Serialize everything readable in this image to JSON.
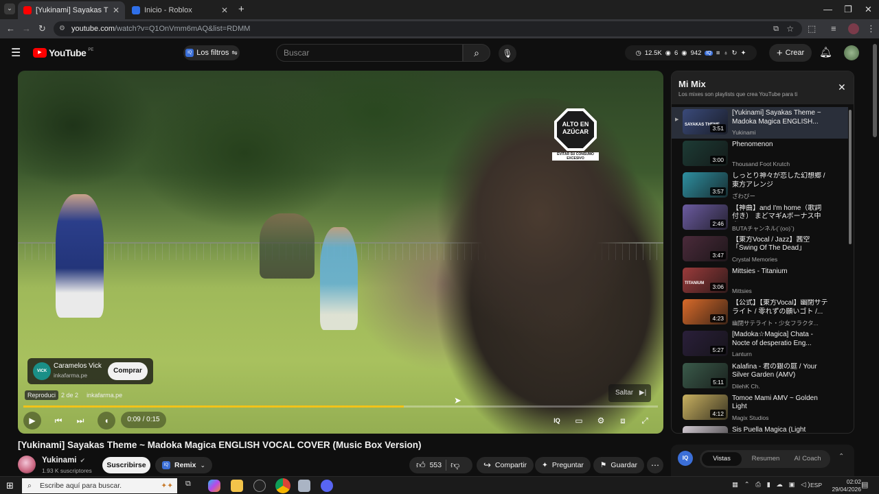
{
  "browser": {
    "tabs": [
      {
        "title": "[Yukinami] Sayakas Theme ~ M",
        "active": true
      },
      {
        "title": "Inicio - Roblox",
        "active": false
      }
    ],
    "url_host": "youtube.com",
    "url_path": "/watch?v=Q1OnVmm6mAQ&list=RDMM",
    "new_tab": "+"
  },
  "yt": {
    "logo": "YouTube",
    "region": "PE",
    "filters_label": "Los filtros",
    "search_placeholder": "Buscar",
    "stats": {
      "views": "12.5K",
      "watching": "6",
      "total": "942"
    },
    "create_label": "Crear"
  },
  "player": {
    "sign_text": "ALTO EN AZÚCAR",
    "sign_sub": "EVITAR SU CONSUMO EXCESIVO",
    "ad_name": "Caramelos Vick",
    "ad_domain": "inkafarma.pe",
    "ad_logo": "VICK",
    "buy_label": "Comprar",
    "ad_info_label": "Reproduci",
    "ad_info_count": "2 de 2",
    "ad_info_domain": "inkafarma.pe",
    "skip_label": "Saltar",
    "time": "0:09 / 0:15",
    "progress": 0.6
  },
  "video": {
    "title": "[Yukinami] Sayakas Theme ~ Madoka Magica ENGLISH VOCAL COVER (Music Box Version)",
    "channel": "Yukinami",
    "subs": "1.93 K suscriptores",
    "subscribe_label": "Suscribirse",
    "remix_label": "Remix",
    "likes": "553",
    "share_label": "Compartir",
    "ask_label": "Preguntar",
    "save_label": "Guardar"
  },
  "mix": {
    "title": "Mi Mix",
    "subtitle": "Los mixes son playlists que crea YouTube para ti",
    "items": [
      {
        "title": "[Yukinami] Sayakas Theme ~ Madoka Magica ENGLISH...",
        "artist": "Yukinami",
        "duration": "3:51",
        "thumb": "#3a4a7a",
        "current": true,
        "thumb_text": "SAYAKAS THEME"
      },
      {
        "title": "Phenomenon",
        "artist": "Thousand Foot Krutch",
        "duration": "3:00",
        "thumb": "#1d3b35",
        "current": false,
        "thumb_text": ""
      },
      {
        "title": "しっとり神々が恋した幻想郷 / 東方アレンジ",
        "artist": "ざわびー",
        "duration": "3:57",
        "thumb": "#2e8fa0",
        "current": false,
        "thumb_text": ""
      },
      {
        "title": "【神曲】and I'm home（歌詞付き） まどマギAボーナス中楽...",
        "artist": "BUTAチャンネル(´(oo)`)",
        "duration": "2:46",
        "thumb": "#6b5ba0",
        "current": false,
        "thumb_text": ""
      },
      {
        "title": "【東方Vocal / Jazz】茜空「Swing Of The Dead」",
        "artist": "Crystal Memories",
        "duration": "3:47",
        "thumb": "#4a2a3a",
        "current": false,
        "thumb_text": ""
      },
      {
        "title": "Mittsies - Titanium",
        "artist": "Mittsies",
        "duration": "3:06",
        "thumb": "#9a3b3b",
        "current": false,
        "thumb_text": "TITANIUM"
      },
      {
        "title": "【公式】【東方Vocal】幽閉サテライト / 零れずの願いゴト /...",
        "artist": "幽閉サテライト・少女フラクタ...",
        "duration": "4:23",
        "thumb": "#d86a2a",
        "current": false,
        "thumb_text": ""
      },
      {
        "title": "[Madoka☆Magica] Chata - Nocte of desperatio Eng...",
        "artist": "Lanturn",
        "duration": "5:27",
        "thumb": "#2a1f3a",
        "current": false,
        "thumb_text": ""
      },
      {
        "title": "Kalafina - 君の銀の庭 / Your Silver Garden (AMV)",
        "artist": "DilehK Ch.",
        "duration": "5:11",
        "thumb": "#3a5a4a",
        "current": false,
        "thumb_text": ""
      },
      {
        "title": "Tomoe Mami AMV ~ Golden Light",
        "artist": "Magix Studios",
        "duration": "4:12",
        "thumb": "#c8b060",
        "current": false,
        "thumb_text": ""
      },
      {
        "title": "Sis Puella Magica (Light",
        "artist": "",
        "duration": "",
        "thumb": "#d0c8d0",
        "current": false,
        "thumb_text": ""
      }
    ]
  },
  "sidepanel": {
    "tabs": [
      "Vistas",
      "Resumen",
      "AI Coach"
    ],
    "active": "Vistas"
  },
  "taskbar": {
    "search_placeholder": "Escribe aquí para buscar.",
    "time": "02:02",
    "date": "29/04/2026",
    "lang": "ESP"
  },
  "colors": {
    "accent_red": "#ff0000",
    "progress_yellow": "#f2c318",
    "bg": "#0f0f0f"
  }
}
